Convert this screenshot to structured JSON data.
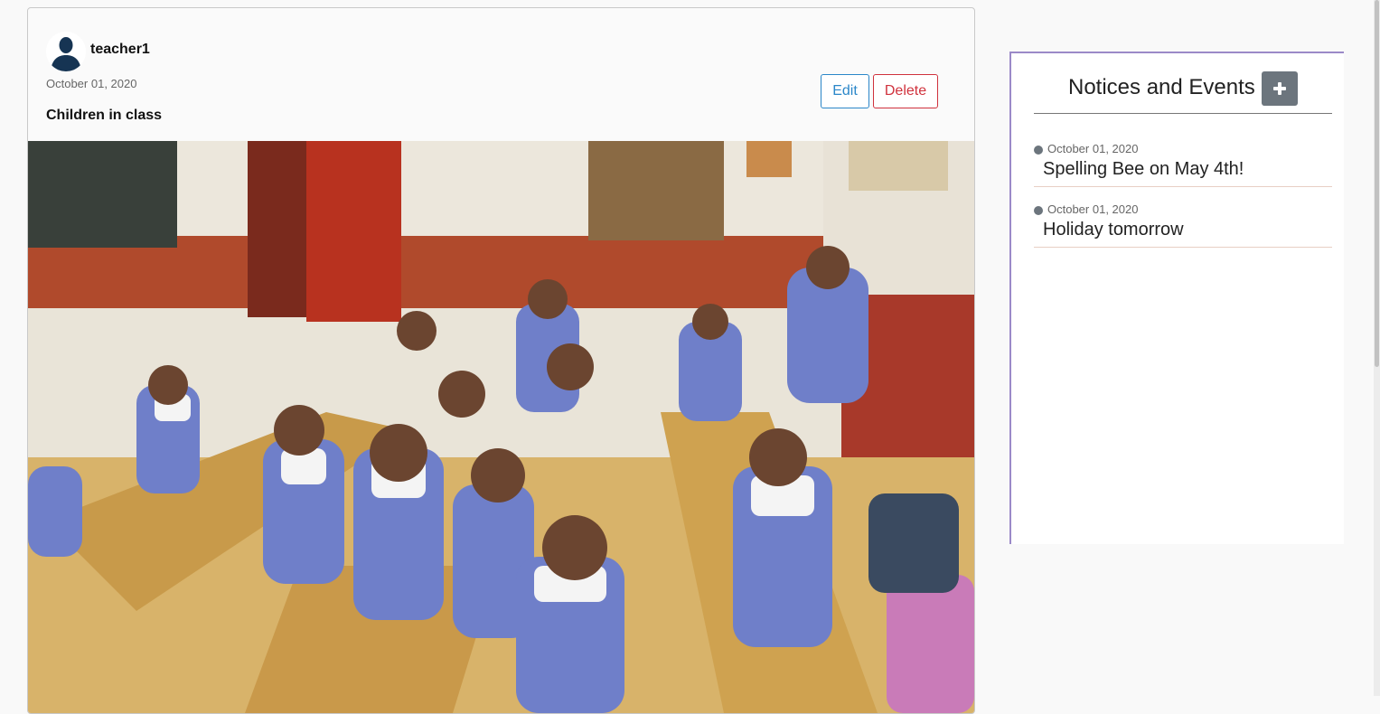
{
  "post": {
    "author": "teacher1",
    "date": "October 01, 2020",
    "caption": "Children in class",
    "edit_label": "Edit",
    "delete_label": "Delete",
    "image_alt": "Children in class"
  },
  "notices": {
    "title": "Notices and Events",
    "add_icon": "plus-icon",
    "items": [
      {
        "date": "October 01, 2020",
        "text": "Spelling Bee on May 4th!"
      },
      {
        "date": "October 01, 2020",
        "text": "Holiday tomorrow"
      }
    ]
  },
  "colors": {
    "edit_blue": "#2b87c9",
    "delete_red": "#d0323d",
    "panel_accent": "#9b8ac8",
    "add_button": "#6c757d"
  }
}
